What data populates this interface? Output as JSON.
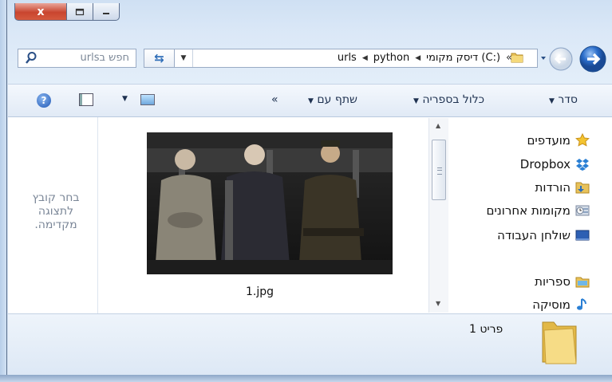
{
  "window": {
    "caption_buttons": {
      "close": "x",
      "maximize": "maximize-icon",
      "minimize": "minimize-icon"
    }
  },
  "address_bar": {
    "search_placeholder": "חפש בurls",
    "breadcrumbs": [
      "דיסק מקומי (C:)",
      "python",
      "urls"
    ],
    "overflow": "«"
  },
  "toolbar": {
    "organize": "סדר",
    "include_in_library": "כלול בספריה",
    "share_with": "שתף עם",
    "more": "«"
  },
  "preview_pane": {
    "text": "בחר קובץ לתצוגה מקדימה."
  },
  "file": {
    "name": "1.jpg"
  },
  "nav": {
    "items": [
      {
        "label": "מועדפים",
        "icon": "star-icon"
      },
      {
        "label": "Dropbox",
        "icon": "dropbox-icon"
      },
      {
        "label": "הורדות",
        "icon": "downloads-folder-icon"
      },
      {
        "label": "מקומות אחרונים",
        "icon": "recent-places-icon"
      },
      {
        "label": "שולחן העבודה",
        "icon": "desktop-icon"
      },
      {
        "label": "ספריות",
        "icon": "libraries-icon"
      },
      {
        "label": "מוסיקה",
        "icon": "music-icon"
      }
    ]
  },
  "status": {
    "item_count": "פריט 1"
  },
  "colors": {
    "accent": "#2f6eb8",
    "chrome": "#dbe8f7",
    "close": "#c9452f"
  }
}
